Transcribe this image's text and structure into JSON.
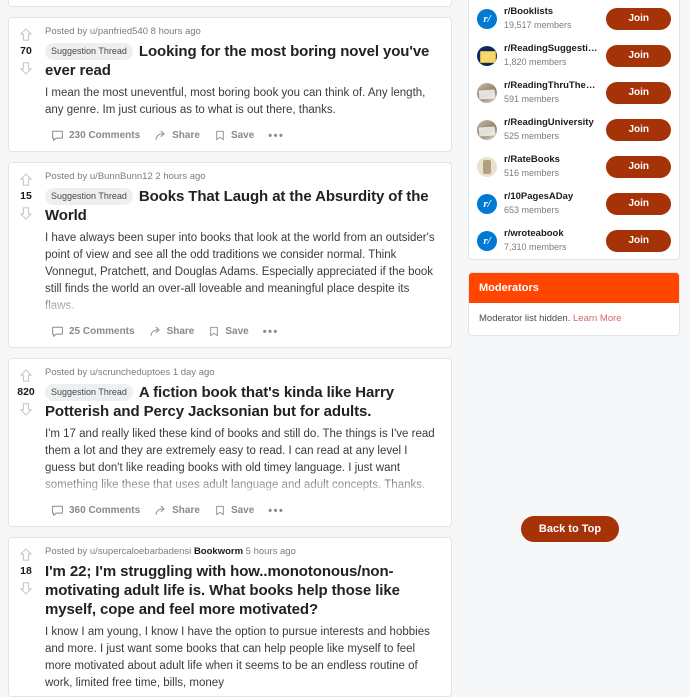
{
  "feed": {
    "posts": [
      {
        "score": "70",
        "byline_prefix": "Posted by",
        "author": "u/panfried540",
        "user_flair": "",
        "time": "8 hours ago",
        "flair": "Suggestion Thread",
        "title": "Looking for the most boring novel you've ever read",
        "body": "I mean the most uneventful, most boring book you can think of. Any length, any genre. Im just curious as to what is out there, thanks.",
        "faded": false,
        "comments": "230 Comments",
        "share": "Share",
        "save": "Save"
      },
      {
        "score": "15",
        "byline_prefix": "Posted by",
        "author": "u/BunnBunn12",
        "user_flair": "",
        "time": "2 hours ago",
        "flair": "Suggestion Thread",
        "title": "Books That Laugh at the Absurdity of the World",
        "body": "I have always been super into books that look at the world from an outsider's point of view and see all the odd traditions we consider normal. Think Vonnegut, Pratchett, and Douglas Adams. Especially appreciated if the book still finds the world an over-all loveable and meaningful place despite its flaws.",
        "faded": true,
        "comments": "25 Comments",
        "share": "Share",
        "save": "Save"
      },
      {
        "score": "820",
        "byline_prefix": "Posted by",
        "author": "u/scruncheduptoes",
        "user_flair": "",
        "time": "1 day ago",
        "flair": "Suggestion Thread",
        "title": "A fiction book that's kinda like Harry Potterish and Percy Jacksonian but for adults.",
        "body": "I'm 17 and really liked these kind of books and still do. The things is I've read them a lot and they are extremely easy to read. I can read at any level I guess but don't like reading books with old timey language. I just want something like these that uses adult language and adult concepts. Thanks.",
        "faded": true,
        "comments": "360 Comments",
        "share": "Share",
        "save": "Save"
      },
      {
        "score": "18",
        "byline_prefix": "Posted by",
        "author": "u/supercaloebarbadensi",
        "user_flair": "Bookworm",
        "time": "5 hours ago",
        "flair": "",
        "title": "I'm 22; I'm struggling with how..monotonous/non-motivating adult life is. What books help those like myself, cope and feel more motivated?",
        "body": "I know I am young, I know I have the option to pursue interests and hobbies and more. I just want some books that can help people like myself to feel more motivated about adult life when it seems to be an endless routine of work, limited free time, bills, money",
        "faded": false,
        "comments": "",
        "share": "",
        "save": ""
      }
    ]
  },
  "sidebar": {
    "communities": [
      {
        "name": "r/Booklists",
        "members": "19,517 members",
        "join": "Join",
        "icon": "snoo-icon"
      },
      {
        "name": "r/ReadingSuggestions",
        "members": "1,820 members",
        "join": "Join",
        "icon": "blue-book-icon"
      },
      {
        "name": "r/ReadingThruTheWorld",
        "members": "591 members",
        "join": "Join",
        "icon": "photo-books-icon"
      },
      {
        "name": "r/ReadingUniversity",
        "members": "525 members",
        "join": "Join",
        "icon": "photo-books-icon"
      },
      {
        "name": "r/RateBooks",
        "members": "516 members",
        "join": "Join",
        "icon": "beige-statue-icon"
      },
      {
        "name": "r/10PagesADay",
        "members": "653 members",
        "join": "Join",
        "icon": "snoo-icon"
      },
      {
        "name": "r/wroteabook",
        "members": "7,310 members",
        "join": "Join",
        "icon": "snoo-icon"
      }
    ],
    "moderators": {
      "header": "Moderators",
      "hidden_text": "Moderator list hidden.",
      "learn_more": "Learn More"
    },
    "back_to_top": "Back to Top"
  },
  "colors": {
    "join_button": "#a63208",
    "moderators_header": "#ff4500",
    "page_background": "#f6f7f8",
    "card_background": "#ffffff",
    "link": "#d3686a"
  }
}
